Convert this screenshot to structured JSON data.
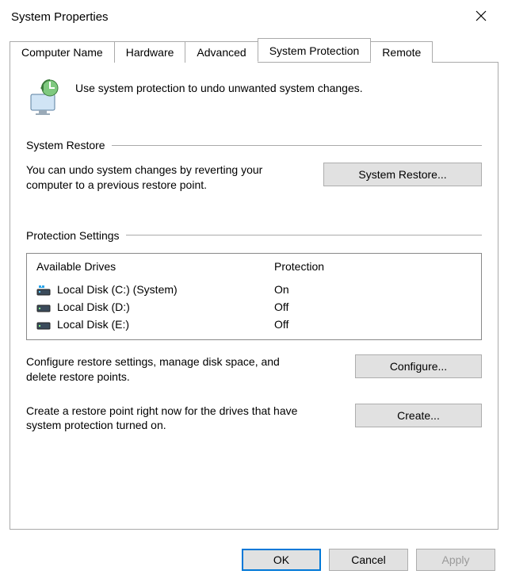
{
  "window": {
    "title": "System Properties"
  },
  "tabs": [
    {
      "label": "Computer Name"
    },
    {
      "label": "Hardware"
    },
    {
      "label": "Advanced"
    },
    {
      "label": "System Protection"
    },
    {
      "label": "Remote"
    }
  ],
  "intro_text": "Use system protection to undo unwanted system changes.",
  "restore_section": {
    "title": "System Restore",
    "text": "You can undo system changes by reverting your computer to a previous restore point.",
    "button": "System Restore..."
  },
  "protection_section": {
    "title": "Protection Settings",
    "col_drive": "Available Drives",
    "col_prot": "Protection",
    "drives": [
      {
        "name": "Local Disk (C:) (System)",
        "protection": "On",
        "system": true
      },
      {
        "name": "Local Disk (D:)",
        "protection": "Off",
        "system": false
      },
      {
        "name": "Local Disk (E:)",
        "protection": "Off",
        "system": false
      }
    ],
    "configure_text": "Configure restore settings, manage disk space, and delete restore points.",
    "configure_button": "Configure...",
    "create_text": "Create a restore point right now for the drives that have system protection turned on.",
    "create_button": "Create..."
  },
  "dialog_buttons": {
    "ok": "OK",
    "cancel": "Cancel",
    "apply": "Apply"
  }
}
